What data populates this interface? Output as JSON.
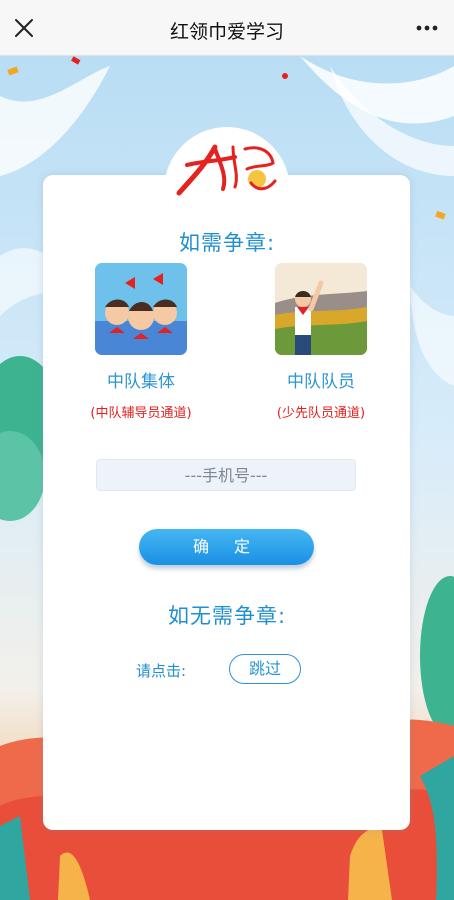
{
  "nav": {
    "title": "红领巾爱学习",
    "close_icon": "close-icon",
    "more_icon": "more-icon"
  },
  "logo": {
    "text": "红领巾爱学习"
  },
  "need_badge": {
    "heading": "如需争章:",
    "options": [
      {
        "label": "中队集体",
        "sub": "(中队辅导员通道)",
        "icon": "group-illustration"
      },
      {
        "label": "中队队员",
        "sub": "(少先队员通道)",
        "icon": "pioneer-illustration"
      }
    ]
  },
  "phone": {
    "placeholder": "---手机号---",
    "value": ""
  },
  "confirm_label": "确 定",
  "no_badge": {
    "heading": "如无需争章:",
    "click_label": "请点击:",
    "skip_label": "跳过"
  },
  "colors": {
    "accent": "#1f8fd1",
    "red": "#e5221f",
    "button": "#2e9fea"
  }
}
